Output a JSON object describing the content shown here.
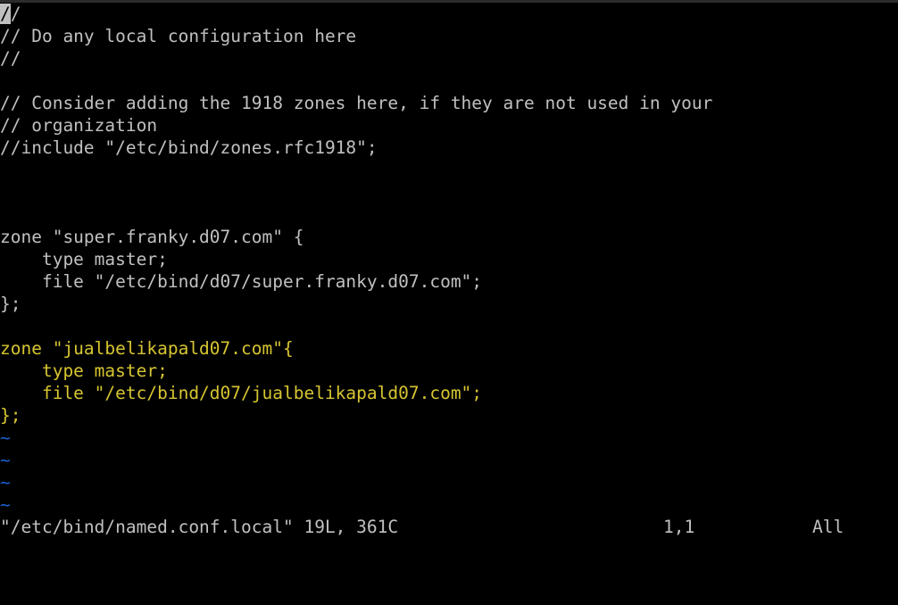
{
  "buffer": {
    "cursor_char": "/",
    "lines": [
      {
        "text": "/",
        "color": "white"
      },
      {
        "text": "// Do any local configuration here",
        "color": "white"
      },
      {
        "text": "//",
        "color": "white"
      },
      {
        "text": "",
        "color": "white"
      },
      {
        "text": "// Consider adding the 1918 zones here, if they are not used in your",
        "color": "white"
      },
      {
        "text": "// organization",
        "color": "white"
      },
      {
        "text": "//include \"/etc/bind/zones.rfc1918\";",
        "color": "white"
      },
      {
        "text": "",
        "color": "white"
      },
      {
        "text": "",
        "color": "white"
      },
      {
        "text": "",
        "color": "white"
      },
      {
        "text": "zone \"super.franky.d07.com\" {",
        "color": "white"
      },
      {
        "text": "    type master;",
        "color": "white"
      },
      {
        "text": "    file \"/etc/bind/d07/super.franky.d07.com\";",
        "color": "white"
      },
      {
        "text": "};",
        "color": "white"
      },
      {
        "text": "",
        "color": "white"
      },
      {
        "text": "zone \"jualbelikapald07.com\"{",
        "color": "yellow"
      },
      {
        "text": "    type master;",
        "color": "yellow"
      },
      {
        "text": "    file \"/etc/bind/d07/jualbelikapald07.com\";",
        "color": "yellow"
      },
      {
        "text": "};",
        "color": "yellow"
      }
    ],
    "empty_line_markers": [
      "~",
      "~",
      "~",
      "~"
    ]
  },
  "status_line": {
    "file_info": "\"/etc/bind/named.conf.local\" 19L, 361C",
    "cursor_position": "1,1",
    "view_position": "All"
  },
  "colors": {
    "background": "#000000",
    "text": "#c0c0c0",
    "highlight_yellow": "#d7c531",
    "tilde_blue": "#1a5fd0"
  }
}
